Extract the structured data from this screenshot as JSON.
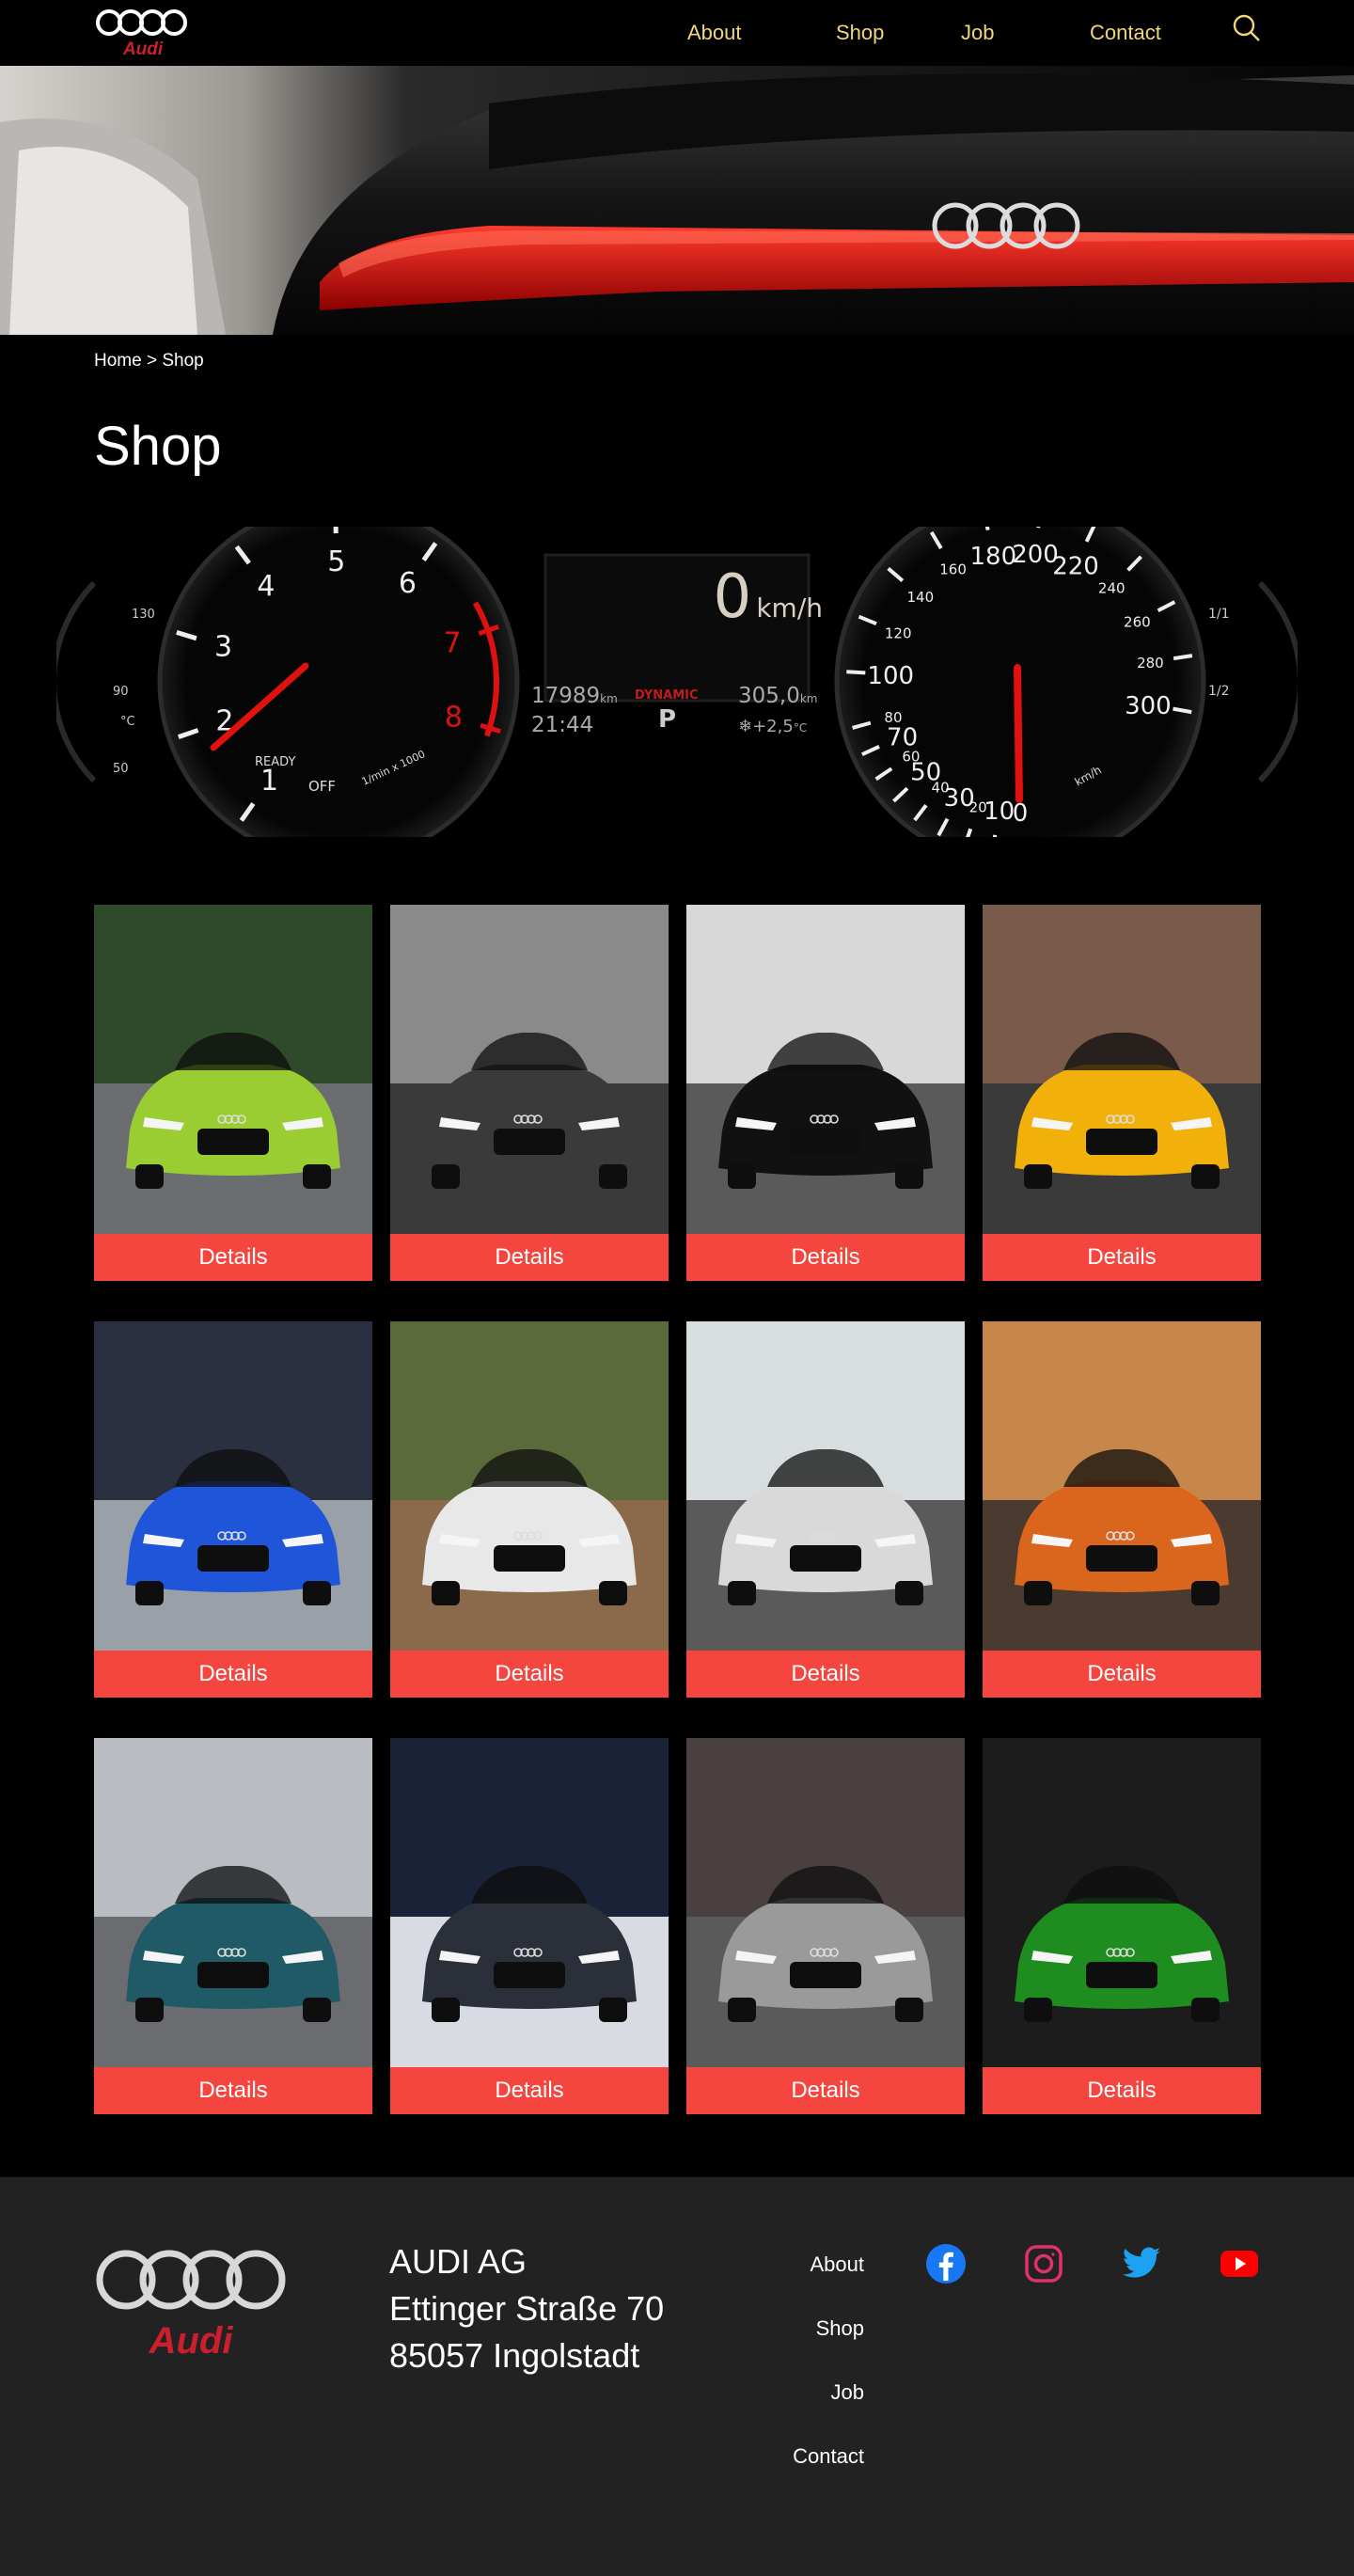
{
  "nav": {
    "brand": "Audi",
    "links": [
      "About",
      "Shop",
      "Job",
      "Contact"
    ],
    "search_icon": "search-icon"
  },
  "colors": {
    "accent": "#f5453f",
    "nav_link": "#f0d77a",
    "footer_bg": "#222222",
    "audi_red": "#cc1f2d"
  },
  "breadcrumb": "Home > Shop",
  "page_title": "Shop",
  "dashboard": {
    "speed": "0",
    "speed_unit": "km/h",
    "odometer": "17989",
    "odometer_unit": "km",
    "time": "21:44",
    "mode": "DYNAMIC",
    "gear": "P",
    "trip": "305,0",
    "trip_unit": "km",
    "temperature": "+2,5",
    "temperature_unit": "°C",
    "tacho_ticks": [
      "1",
      "2",
      "3",
      "4",
      "5",
      "6",
      "7",
      "8"
    ],
    "tacho_ready": "READY",
    "tacho_off": "OFF",
    "tacho_unit": "1/min x 1000",
    "speedo_major": [
      "0",
      "10",
      "20",
      "30",
      "40",
      "50",
      "60",
      "70",
      "80",
      "100",
      "120",
      "140",
      "160",
      "180",
      "200",
      "220",
      "240",
      "260",
      "280",
      "300"
    ],
    "speedo_unit": "km/h",
    "left_gauge": [
      "50",
      "90",
      "130"
    ],
    "left_gauge_unit": "°C",
    "right_gauge": [
      "1/1",
      "1/2"
    ]
  },
  "products": [
    {
      "button": "Details",
      "color": "#9acd32"
    },
    {
      "button": "Details",
      "color": "#3a3a3a"
    },
    {
      "button": "Details",
      "color": "#111111"
    },
    {
      "button": "Details",
      "color": "#f2b10a"
    },
    {
      "button": "Details",
      "color": "#1f55d8"
    },
    {
      "button": "Details",
      "color": "#e8e8e8"
    },
    {
      "button": "Details",
      "color": "#d9d9d9"
    },
    {
      "button": "Details",
      "color": "#d9661c"
    },
    {
      "button": "Details",
      "color": "#1f5a66"
    },
    {
      "button": "Details",
      "color": "#2a2f3a"
    },
    {
      "button": "Details",
      "color": "#9a9a9a"
    },
    {
      "button": "Details",
      "color": "#1f8c1f"
    }
  ],
  "footer": {
    "brand": "Audi",
    "company": "AUDI AG",
    "street": "Ettinger Straße 70",
    "city": "85057 Ingolstadt",
    "links": [
      "About",
      "Shop",
      "Job",
      "Contact"
    ],
    "social": [
      "facebook-icon",
      "instagram-icon",
      "twitter-icon",
      "youtube-icon"
    ]
  }
}
